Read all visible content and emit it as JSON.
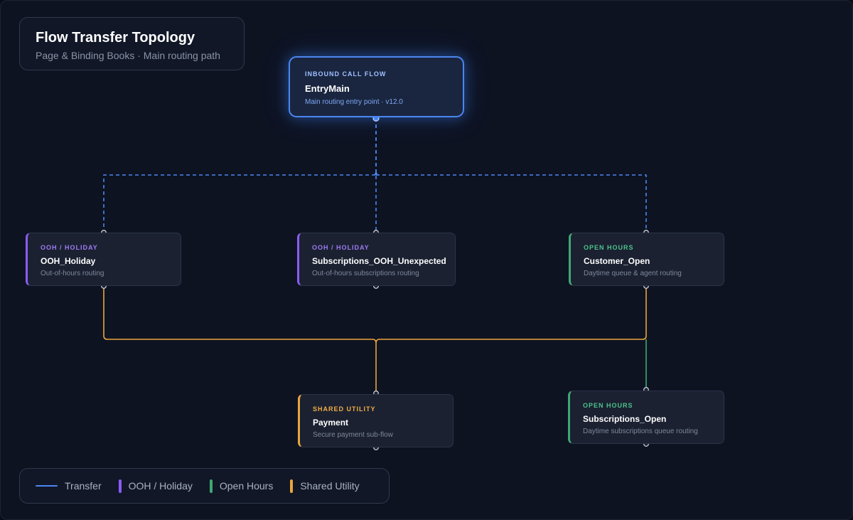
{
  "header": {
    "title": "Flow Transfer Topology",
    "subtitle": "Page & Binding Books · Main routing path"
  },
  "colors": {
    "transfer": "#4b86f0",
    "ooh_holiday": "#8b5cf6",
    "open_hours": "#3fa873",
    "shared_utility": "#e9a53c"
  },
  "nodes": {
    "entry": {
      "category": "INBOUND CALL FLOW",
      "name": "EntryMain",
      "description": "Main routing entry point · v12.0"
    },
    "ooh_holiday": {
      "category": "OOH / HOLIDAY",
      "name": "OOH_Holiday",
      "description": "Out-of-hours routing"
    },
    "subs_ooh": {
      "category": "OOH / HOLIDAY",
      "name": "Subscriptions_OOH_Unexpected",
      "description": "Out-of-hours subscriptions routing"
    },
    "customer_open": {
      "category": "OPEN HOURS",
      "name": "Customer_Open",
      "description": "Daytime queue & agent routing"
    },
    "payment": {
      "category": "SHARED UTILITY",
      "name": "Payment",
      "description": "Secure payment sub-flow"
    },
    "subs_open": {
      "category": "OPEN HOURS",
      "name": "Subscriptions_Open",
      "description": "Daytime subscriptions queue routing"
    }
  },
  "legend": {
    "transfer": "Transfer",
    "ooh_holiday": "OOH / Holiday",
    "open_hours": "Open Hours",
    "shared_utility": "Shared Utility"
  }
}
